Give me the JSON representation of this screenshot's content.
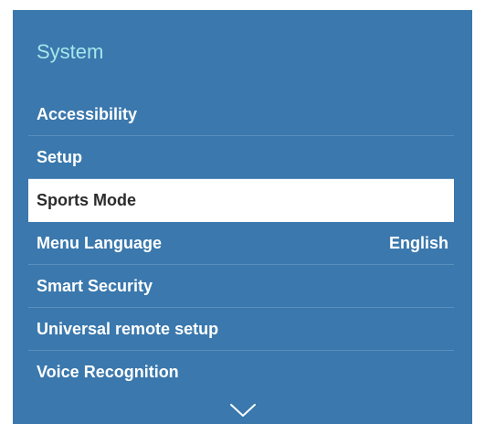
{
  "panel": {
    "title": "System",
    "colors": {
      "panel_bg": "#3a78ad",
      "title": "#a7e6ec",
      "selected_bg": "#ffffff"
    }
  },
  "menu": {
    "selected_index": 2,
    "items": [
      {
        "label": "Accessibility",
        "value": ""
      },
      {
        "label": "Setup",
        "value": ""
      },
      {
        "label": "Sports Mode",
        "value": ""
      },
      {
        "label": "Menu Language",
        "value": "English"
      },
      {
        "label": "Smart Security",
        "value": ""
      },
      {
        "label": "Universal remote setup",
        "value": ""
      },
      {
        "label": "Voice Recognition",
        "value": ""
      }
    ]
  },
  "scroll": {
    "icon": "chevron-down-icon"
  }
}
